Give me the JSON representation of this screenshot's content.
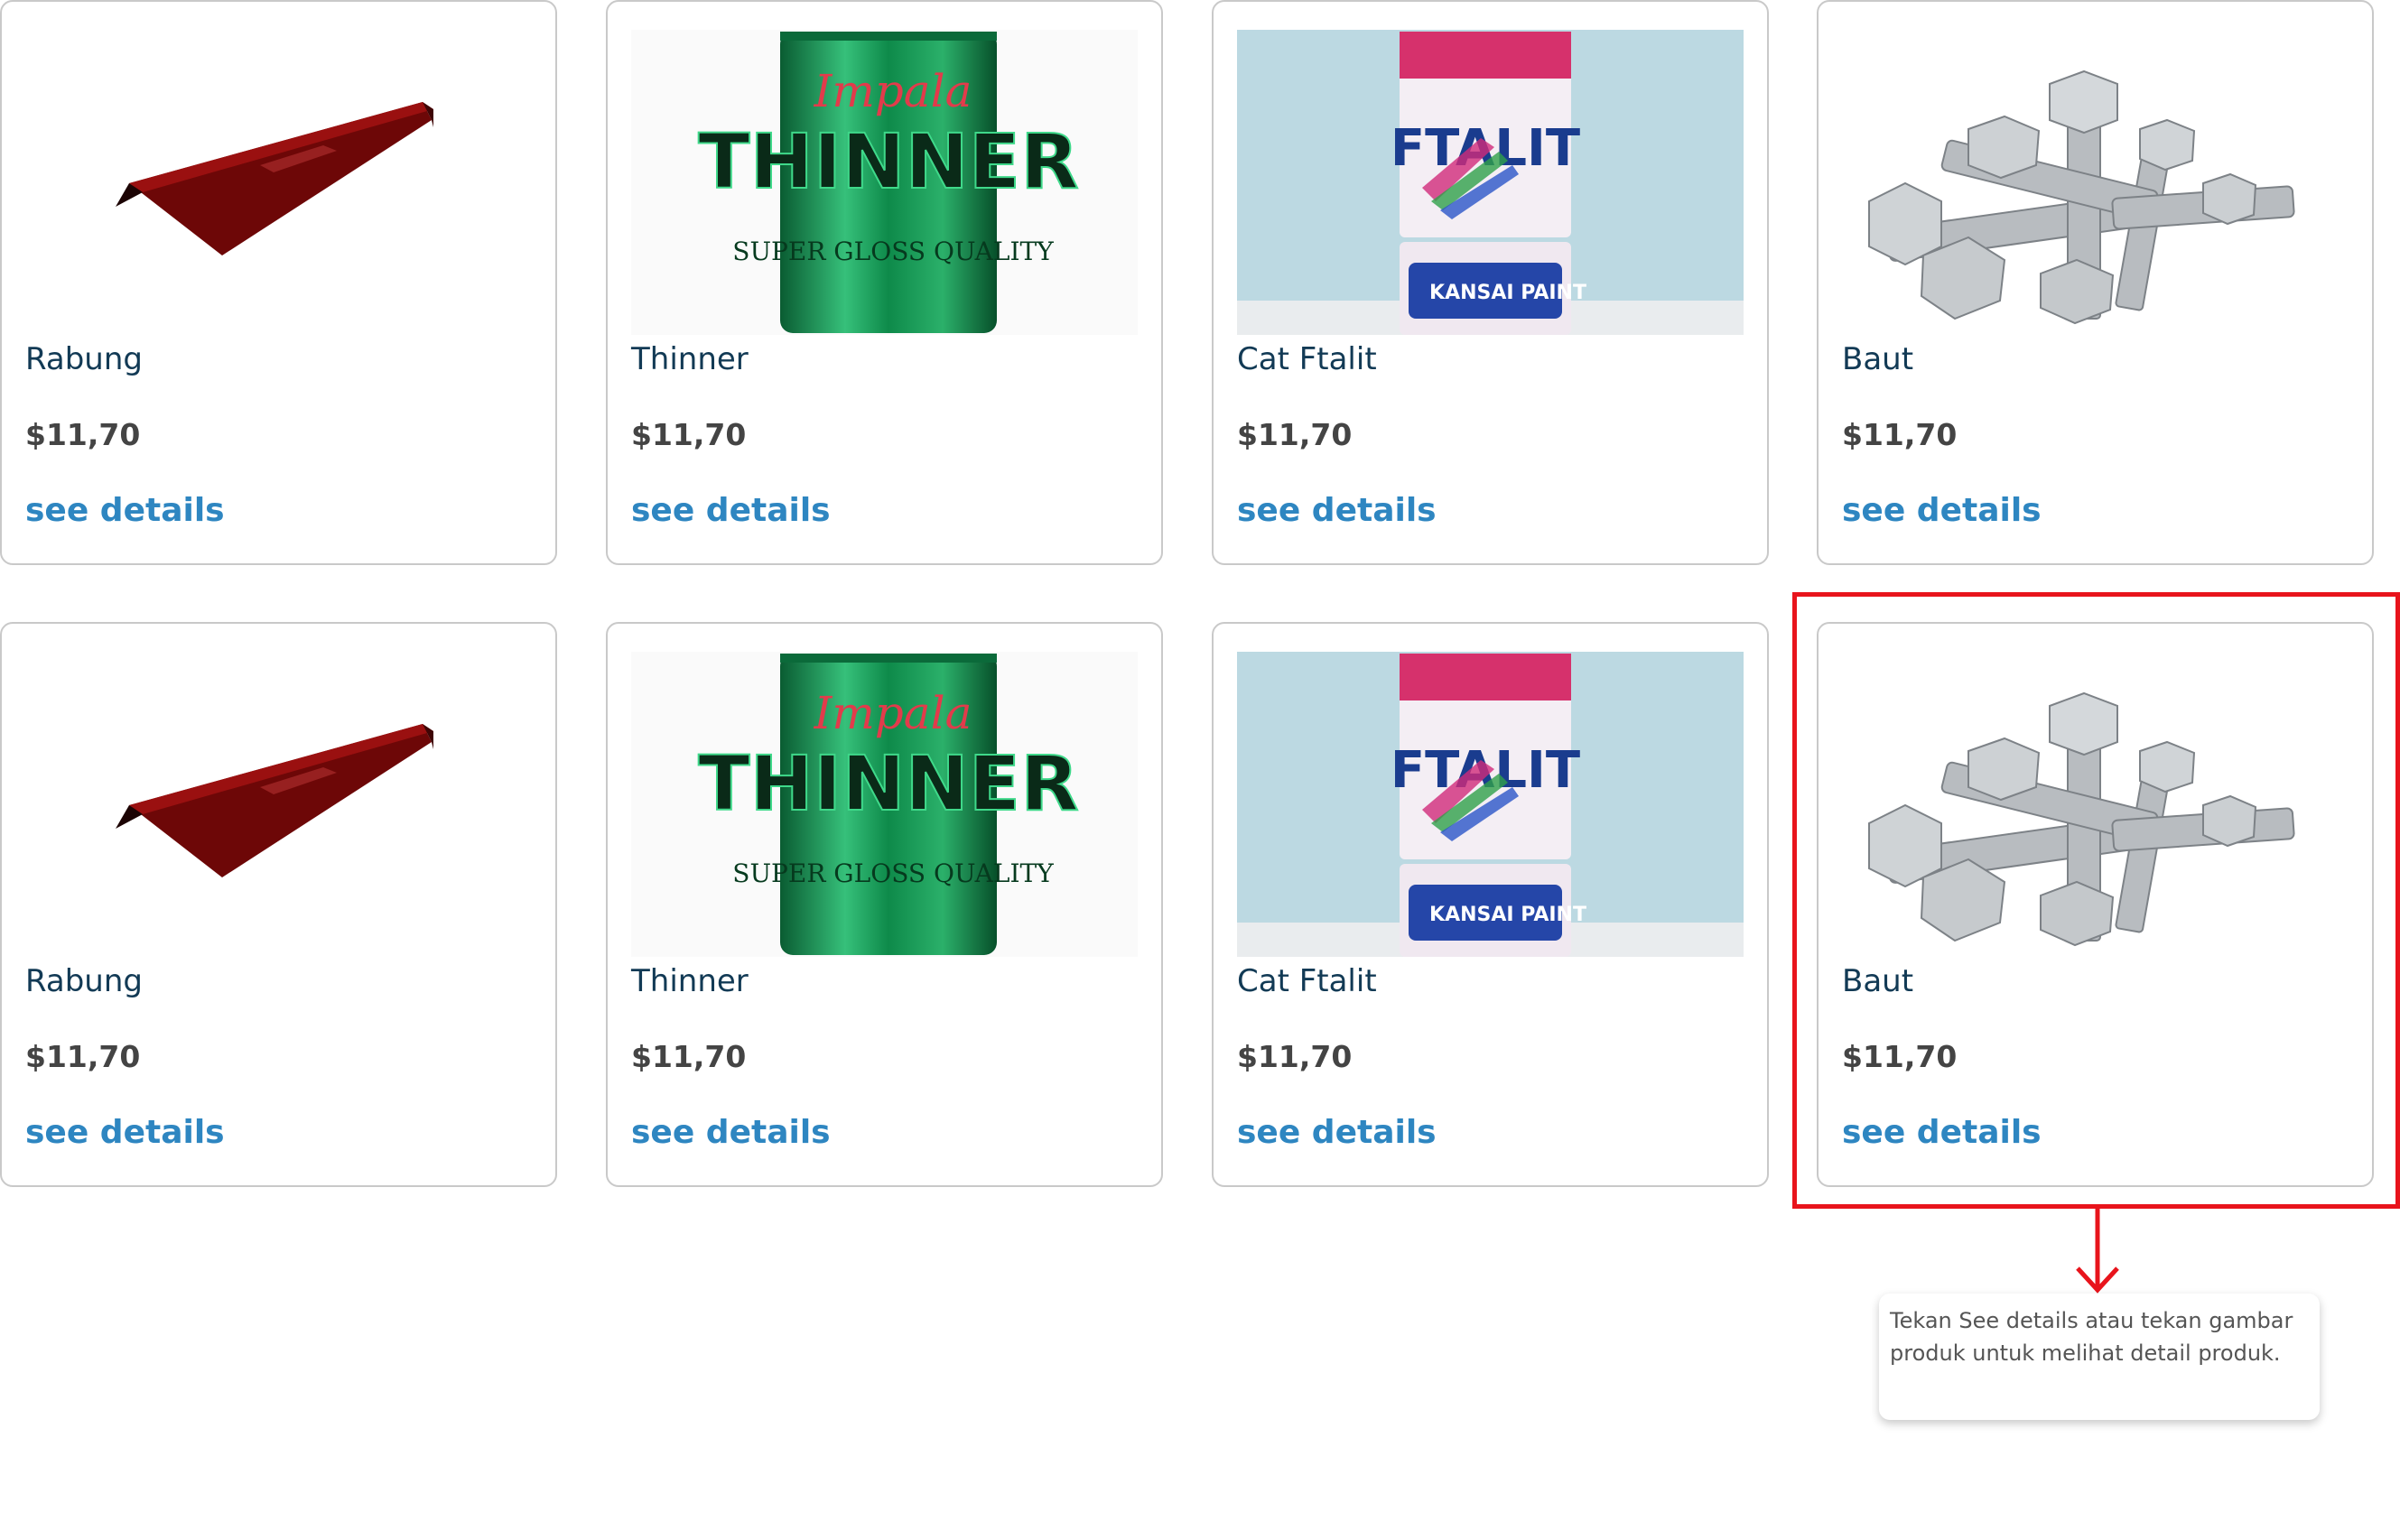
{
  "products": [
    {
      "name": "Rabung",
      "price": "$11,70",
      "link": "see details",
      "image_icon": "roof-ridge-image"
    },
    {
      "name": "Thinner",
      "price": "$11,70",
      "link": "see details",
      "image_icon": "thinner-can-image",
      "image_text": [
        "Impala",
        "THINNER",
        "SUPER GLOSS QUALITY"
      ]
    },
    {
      "name": "Cat Ftalit",
      "price": "$11,70",
      "link": "see details",
      "image_icon": "paint-can-image",
      "image_text": [
        "FTALIT",
        "KANSAI PAINT"
      ]
    },
    {
      "name": "Baut",
      "price": "$11,70",
      "link": "see details",
      "image_icon": "bolts-image"
    },
    {
      "name": "Rabung",
      "price": "$11,70",
      "link": "see details",
      "image_icon": "roof-ridge-image"
    },
    {
      "name": "Thinner",
      "price": "$11,70",
      "link": "see details",
      "image_icon": "thinner-can-image",
      "image_text": [
        "Impala",
        "THINNER",
        "SUPER GLOSS QUALITY"
      ]
    },
    {
      "name": "Cat Ftalit",
      "price": "$11,70",
      "link": "see details",
      "image_icon": "paint-can-image",
      "image_text": [
        "FTALIT",
        "KANSAI PAINT"
      ]
    },
    {
      "name": "Baut",
      "price": "$11,70",
      "link": "see details",
      "image_icon": "bolts-image"
    }
  ],
  "annotation": {
    "text": "Tekan See details atau tekan gambar produk untuk melihat detail produk.",
    "highlight_color": "#e8141c"
  },
  "colors": {
    "name": "#123a55",
    "price": "#444444",
    "link": "#2e86c1"
  }
}
